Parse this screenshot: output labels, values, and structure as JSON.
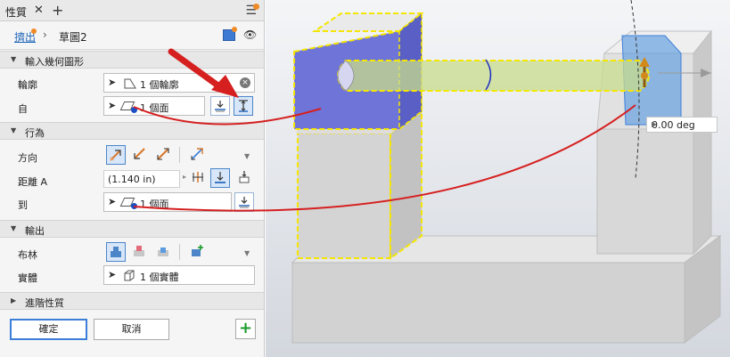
{
  "panel": {
    "tab_title": "性質",
    "close_glyph": "✕",
    "add_tab_glyph": "+",
    "menu_glyph": "☰",
    "breadcrumb": {
      "operation": "擠出",
      "separator": "›",
      "sketch": "草圖2"
    },
    "sections": {
      "input_geometry": "輸入幾何圖形",
      "behavior": "行為",
      "output": "輸出",
      "advanced": "進階性質"
    },
    "input_geometry": {
      "profile_label": "輪廓",
      "profile_value": "1 個輪廓",
      "from_label": "自",
      "from_value": "1 個面"
    },
    "behavior": {
      "direction_label": "方向",
      "distance_label": "距離 A",
      "distance_value": "(1.140 in)",
      "to_label": "到",
      "to_value": "1 個面"
    },
    "output": {
      "boolean_label": "布林",
      "solid_label": "實體",
      "solid_value": "1 個實體"
    },
    "buttons": {
      "ok": "確定",
      "cancel": "取消",
      "add": "+"
    }
  },
  "viewport": {
    "angle_value": "0.00 deg"
  },
  "colors": {
    "accent_blue": "#3d7ed9",
    "selection_face": "#6f74d8",
    "dashed_highlight": "#f5e600",
    "annotation_red": "#d61f1f",
    "badge_orange": "#f08a26"
  }
}
